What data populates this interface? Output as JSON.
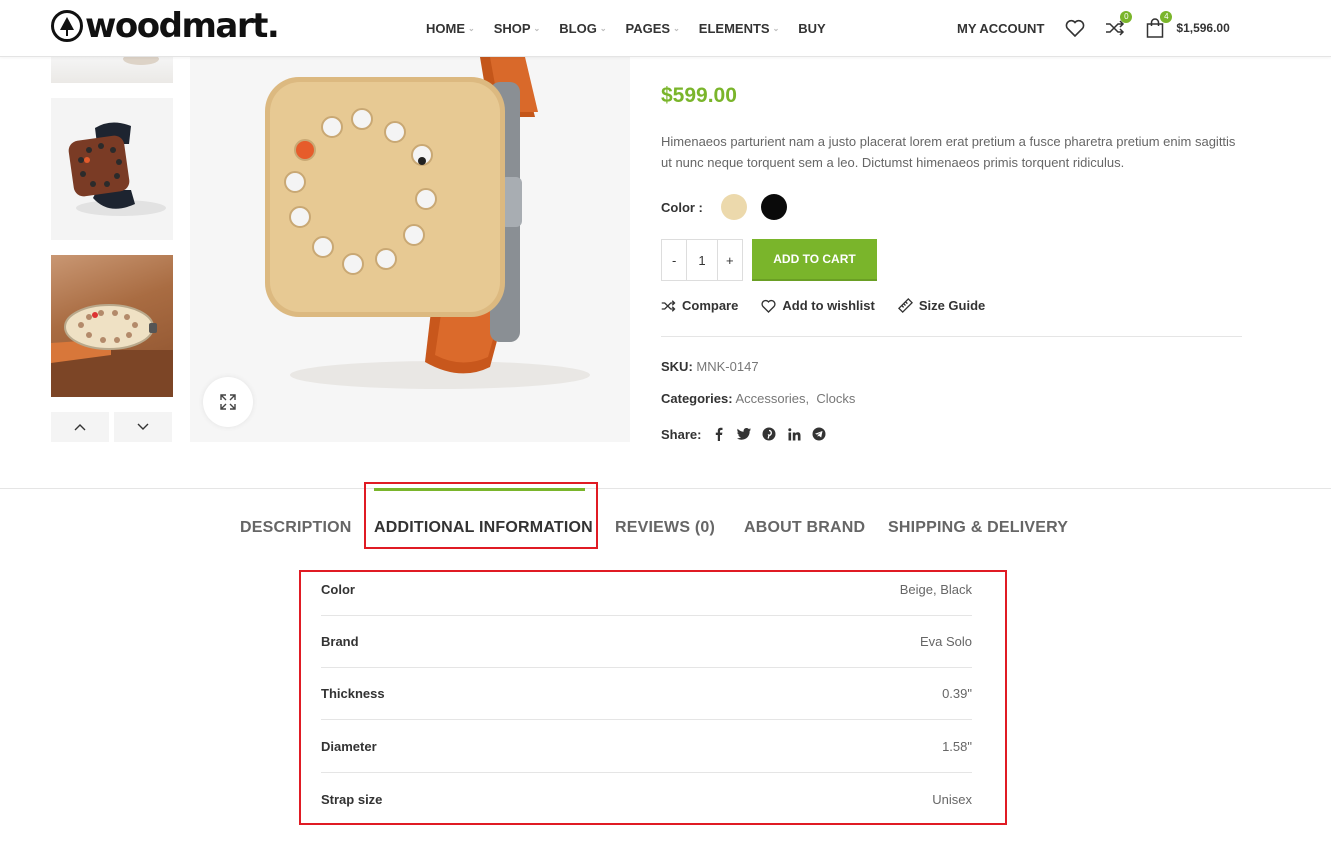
{
  "header": {
    "logo_text": "woodmart.",
    "nav": [
      {
        "label": "HOME",
        "has_dropdown": true
      },
      {
        "label": "SHOP",
        "has_dropdown": true
      },
      {
        "label": "BLOG",
        "has_dropdown": true
      },
      {
        "label": "PAGES",
        "has_dropdown": true
      },
      {
        "label": "ELEMENTS",
        "has_dropdown": true
      },
      {
        "label": "BUY",
        "has_dropdown": false
      }
    ],
    "my_account": "MY ACCOUNT",
    "compare_count": "0",
    "cart_count": "4",
    "cart_total": "$1,596.00"
  },
  "product": {
    "price": "$599.00",
    "description": "Himenaeos parturient nam a justo placerat lorem erat pretium a fusce pharetra pretium enim sagittis ut nunc neque torquent sem a leo. Dictumst himenaeos primis torquent ridiculus.",
    "color_label": "Color :",
    "swatches": [
      "#ecd9ac",
      "#0a0a0a"
    ],
    "qty_minus": "-",
    "qty_value": "1",
    "qty_plus": "+",
    "add_to_cart": "ADD TO CART",
    "compare": "Compare",
    "wishlist": "Add to wishlist",
    "size_guide": "Size Guide",
    "sku_label": "SKU:",
    "sku": "MNK-0147",
    "categories_label": "Categories:",
    "category_1": "Accessories",
    "category_sep": ",",
    "category_2": "Clocks",
    "share_label": "Share:"
  },
  "tabs": {
    "description": "DESCRIPTION",
    "additional": "ADDITIONAL INFORMATION",
    "reviews": "REVIEWS (0)",
    "brand": "ABOUT BRAND",
    "shipping": "SHIPPING & DELIVERY"
  },
  "attributes": [
    {
      "name": "Color",
      "value": "Beige, Black"
    },
    {
      "name": "Brand",
      "value": "Eva Solo"
    },
    {
      "name": "Thickness",
      "value": "0.39\""
    },
    {
      "name": "Diameter",
      "value": "1.58\""
    },
    {
      "name": "Strap size",
      "value": "Unisex"
    }
  ],
  "colors": {
    "accent": "#7ab52b",
    "highlight": "#e01b24"
  }
}
